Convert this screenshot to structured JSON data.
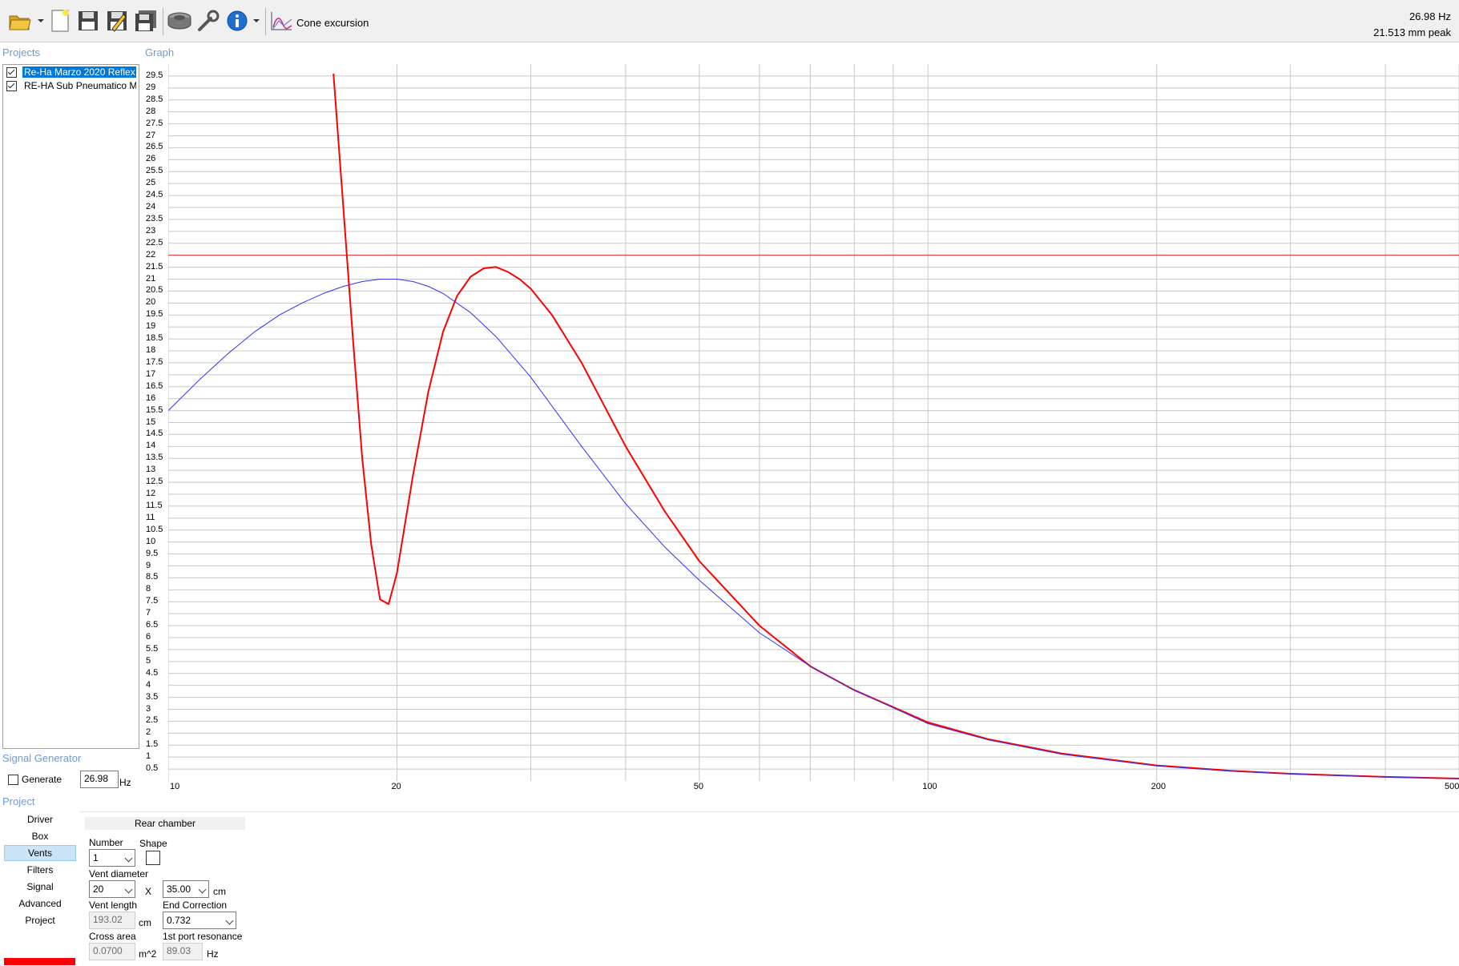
{
  "toolbar": {
    "icons": [
      "open-folder-icon",
      "new-file-icon",
      "save-icon",
      "save-edit-icon",
      "save-as-icon",
      "driver-icon",
      "wrench-icon",
      "info-icon",
      "cone-excursion-icon"
    ],
    "view_label": "Cone excursion"
  },
  "readout": {
    "frequency": "26.98 Hz",
    "value": "21.513 mm peak"
  },
  "projects": {
    "title": "Projects",
    "items": [
      {
        "label": "Re-Ha Marzo 2020 Reflex",
        "checked": true,
        "selected": true
      },
      {
        "label": "RE-HA Sub Pneumatico Ma",
        "checked": true,
        "selected": false
      }
    ]
  },
  "graph": {
    "title": "Graph"
  },
  "signal_generator": {
    "title": "Signal Generator",
    "generate_label": "Generate",
    "frequency_value": "26.98",
    "unit": "Hz"
  },
  "project_nav": {
    "title": "Project",
    "items": [
      "Driver",
      "Box",
      "Vents",
      "Filters",
      "Signal",
      "Advanced",
      "Project"
    ],
    "active": "Vents"
  },
  "vents": {
    "header": "Rear chamber",
    "number_label": "Number",
    "number_value": "1",
    "shape_label": "Shape",
    "diameter_label": "Vent diameter",
    "diameter_value": "20",
    "x_label": "X",
    "depth_value": "35.00",
    "cm_unit": "cm",
    "length_label": "Vent length",
    "length_value": "193.02",
    "end_correction_label": "End Correction",
    "end_correction_value": "0.732",
    "cross_area_label": "Cross area",
    "cross_area_value": "0.0700",
    "area_unit": "m^2",
    "port_res_label": "1st port resonance",
    "port_res_value": "89.03",
    "hz_unit": "Hz"
  },
  "chart_data": {
    "type": "line",
    "x_scale": "log",
    "xlim": [
      10,
      500
    ],
    "ylim": [
      0,
      30
    ],
    "x_ticks": [
      10,
      20,
      50,
      100,
      200,
      500
    ],
    "y_ticks": [
      0.5,
      1,
      1.5,
      2,
      2.5,
      3,
      3.5,
      4,
      4.5,
      5,
      5.5,
      6,
      6.5,
      7,
      7.5,
      8,
      8.5,
      9,
      9.5,
      10,
      10.5,
      11,
      11.5,
      12,
      12.5,
      13,
      13.5,
      14,
      14.5,
      15,
      15.5,
      16,
      16.5,
      17,
      17.5,
      18,
      18.5,
      19,
      19.5,
      20,
      20.5,
      21,
      21.5,
      22,
      22.5,
      23,
      23.5,
      24,
      24.5,
      25,
      25.5,
      26,
      26.5,
      27,
      27.5,
      28,
      28.5,
      29,
      29.5
    ],
    "grid": true,
    "limit_line": {
      "y": 22,
      "color": "#e03030"
    },
    "series": [
      {
        "color": "#ff0000",
        "x": [
          16.5,
          17.0,
          17.5,
          18.0,
          18.5,
          19.0,
          19.5,
          20.0,
          21.0,
          22.0,
          23.0,
          24.0,
          25.0,
          26.0,
          27.0,
          28.0,
          29.0,
          30.0,
          32.0,
          35.0,
          40.0,
          45.0,
          50.0,
          60.0,
          70.0,
          80.0,
          100.0,
          120.0,
          150.0,
          200.0,
          250.0,
          300.0,
          400.0,
          500.0
        ],
        "y": [
          29.6,
          24.0,
          18.5,
          13.5,
          9.9,
          7.6,
          7.4,
          8.7,
          12.8,
          16.3,
          18.8,
          20.3,
          21.1,
          21.45,
          21.51,
          21.3,
          21.0,
          20.6,
          19.5,
          17.5,
          14.0,
          11.3,
          9.2,
          6.5,
          4.8,
          3.8,
          2.45,
          1.75,
          1.15,
          0.65,
          0.43,
          0.3,
          0.17,
          0.1
        ]
      },
      {
        "color": "#3030ff",
        "x": [
          10,
          11,
          12,
          13,
          14,
          15,
          16,
          17,
          18,
          19,
          20,
          21,
          22,
          23,
          25,
          27,
          30,
          35,
          40,
          45,
          50,
          60,
          70,
          80,
          100,
          120,
          150,
          200,
          250,
          300,
          400,
          500
        ],
        "y": [
          15.5,
          16.8,
          17.9,
          18.8,
          19.5,
          20.0,
          20.4,
          20.7,
          20.9,
          21.0,
          21.0,
          20.9,
          20.7,
          20.4,
          19.6,
          18.6,
          16.9,
          14.0,
          11.6,
          9.8,
          8.4,
          6.2,
          4.8,
          3.8,
          2.4,
          1.72,
          1.12,
          0.63,
          0.41,
          0.29,
          0.16,
          0.1
        ]
      }
    ]
  }
}
